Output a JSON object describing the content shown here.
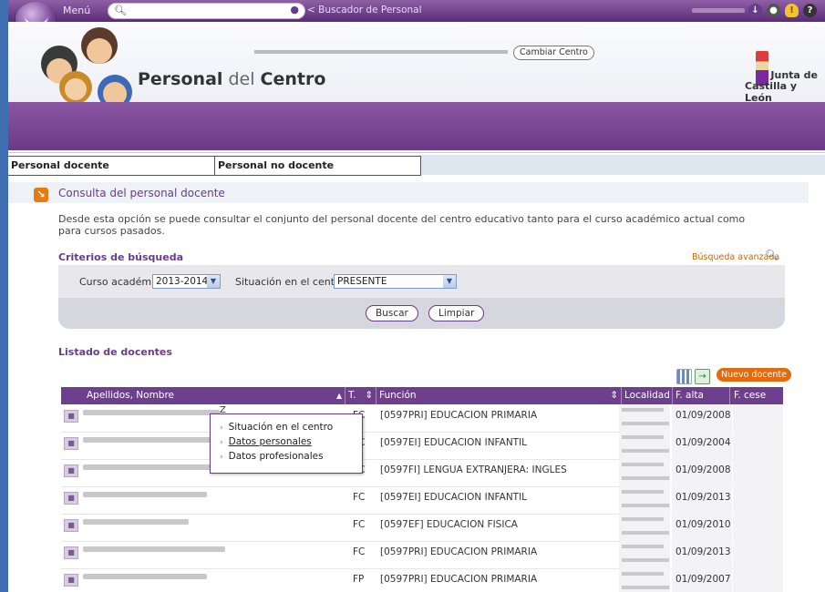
{
  "topbar": {
    "menu_label": "Menú",
    "search_placeholder": "",
    "buscador_label": "< Buscador de Personal",
    "icons": [
      "download-icon",
      "help-icon",
      "lightbulb-icon",
      "question-icon"
    ]
  },
  "header": {
    "title_bold": "Personal",
    "title_light": "del",
    "title_bold2": "Centro",
    "cambiar_label": "Cambiar Centro",
    "brand_line1": "Junta de",
    "brand_line2": "Castilla y León"
  },
  "tabs": [
    {
      "label": "Personal docente"
    },
    {
      "label": "Personal no docente"
    }
  ],
  "section": {
    "title": "Consulta del personal docente",
    "description": "Desde esta opción se puede consultar el conjunto del personal docente del centro educativo tanto para el curso académico actual como para cursos pasados."
  },
  "criteria": {
    "title": "Criterios de búsqueda",
    "advanced_link": "Búsqueda avanzada",
    "curso_label": "Curso académico:",
    "curso_value": "2013-2014",
    "situacion_label": "Situación en el centro:",
    "situacion_value": "PRESENTE",
    "buscar_label": "Buscar",
    "limpiar_label": "Limpiar"
  },
  "listado": {
    "title": "Listado de docentes",
    "nuevo_label": "Nuevo docente",
    "columns": {
      "nombre": "Apellidos, Nombre",
      "t": "T.",
      "funcion": "Función",
      "localidad": "Localidad",
      "falta": "F. alta",
      "fcese": "F. cese"
    },
    "rows": [
      {
        "t": "FC",
        "funcion": "[0597PRI] EDUCACION PRIMARIA",
        "falta": "01/09/2008",
        "fcese": "",
        "name_suffix": "Z"
      },
      {
        "t": "FC",
        "funcion": "[0597EI] EDUCACION INFANTIL",
        "falta": "01/09/2004",
        "fcese": "",
        "name_suffix": ""
      },
      {
        "t": "FC",
        "funcion": "[0597FI] LENGUA EXTRANJERA: INGLES",
        "falta": "01/09/2008",
        "fcese": "",
        "name_suffix": "M"
      },
      {
        "t": "FC",
        "funcion": "[0597EI] EDUCACION INFANTIL",
        "falta": "01/09/2013",
        "fcese": "",
        "name_suffix": ""
      },
      {
        "t": "FC",
        "funcion": "[0597EF] EDUCACION FISICA",
        "falta": "01/09/2010",
        "fcese": "",
        "name_suffix": ""
      },
      {
        "t": "FC",
        "funcion": "[0597PRI] EDUCACION PRIMARIA",
        "falta": "01/09/2013",
        "fcese": "",
        "name_suffix": ""
      },
      {
        "t": "FP",
        "funcion": "[0597PRI] EDUCACION PRIMARIA",
        "falta": "01/09/2007",
        "fcese": "",
        "name_suffix": ""
      }
    ]
  },
  "popup": {
    "items": [
      "Situación en el centro",
      "Datos personales",
      "Datos profesionales"
    ]
  },
  "colors": {
    "brand_purple": "#6d3f8c",
    "accent_orange": "#e46a10"
  }
}
